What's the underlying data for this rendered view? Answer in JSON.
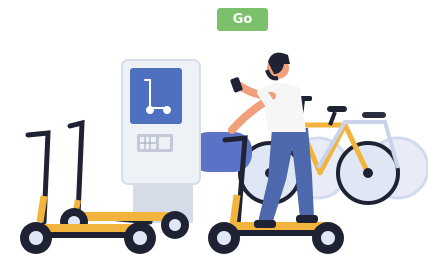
{
  "go_button": {
    "label": "Go"
  },
  "illustration": {
    "name": "scooter-and-bike-sharing-station",
    "colors": {
      "kiosk_screen": "#4f6fbf",
      "kiosk_body": "#eef1f6",
      "scooter_frame": "#f2b43c",
      "scooter_dark": "#1e2233",
      "bike_frame": "#f2b43c",
      "wheel_light": "#dfe6f4",
      "person_shirt": "#f6f6f6",
      "person_pants": "#4d68ad",
      "person_skin": "#f0a07a",
      "seat_blue": "#5a73c7"
    }
  }
}
